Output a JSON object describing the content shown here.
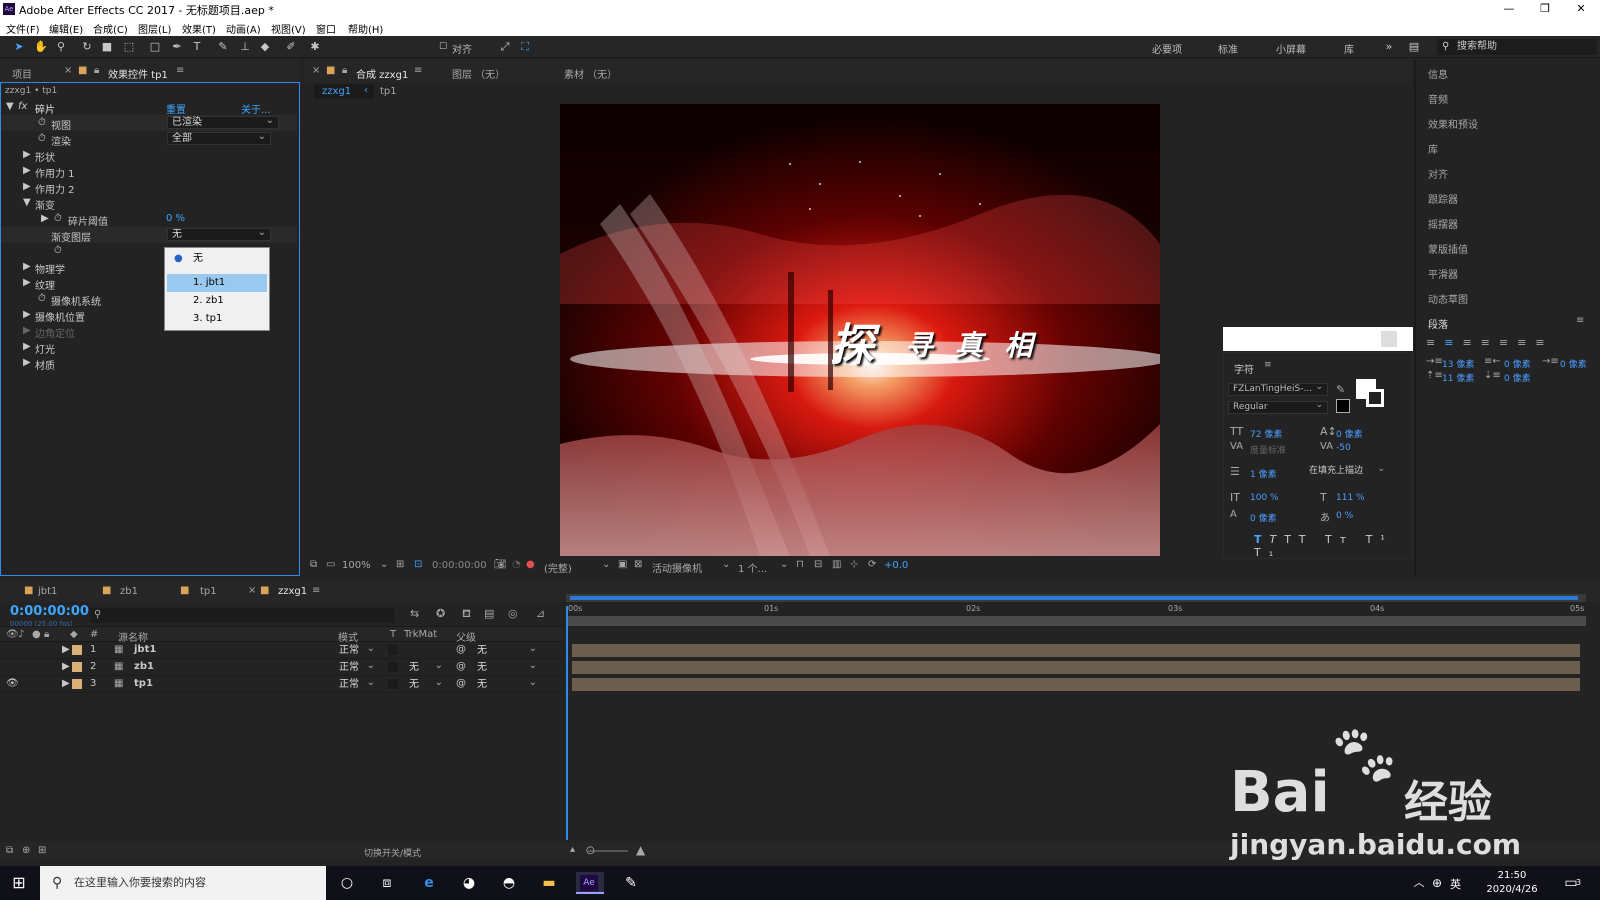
{
  "title_bar": {
    "app_title": "Adobe After Effects CC 2017 - 无标题项目.aep *",
    "logo": "Ae"
  },
  "menu": [
    "文件(F)",
    "编辑(E)",
    "合成(C)",
    "图层(L)",
    "效果(T)",
    "动画(A)",
    "视图(V)",
    "窗口",
    "帮助(H)"
  ],
  "toolbar": {
    "align_label": "对齐",
    "workspaces": [
      "必要项",
      "标准",
      "小屏幕",
      "库"
    ],
    "search_help": "搜索帮助"
  },
  "effects_panel": {
    "tabs": [
      "项目",
      "效果控件 tp1"
    ],
    "breadcrumb": "zzxg1 • tp1",
    "effect_name": "碎片",
    "reset": "重置",
    "about": "关于...",
    "props": [
      {
        "label": "视图",
        "value": "已渲染"
      },
      {
        "label": "渲染",
        "value": "全部"
      },
      {
        "label": "形状"
      },
      {
        "label": "作用力 1"
      },
      {
        "label": "作用力 2"
      },
      {
        "label": "渐变"
      },
      {
        "label": "碎片阈值",
        "value": "0 %"
      },
      {
        "label": "渐变图层",
        "value": "无"
      },
      {
        "label": "物理学"
      },
      {
        "label": "纹理"
      },
      {
        "label": "摄像机系统"
      },
      {
        "label": "摄像机位置"
      },
      {
        "label": "边角定位"
      },
      {
        "label": "灯光"
      },
      {
        "label": "材质"
      }
    ],
    "dropdown_options": [
      "无",
      "1. jbt1",
      "2. zb1",
      "3. tp1"
    ]
  },
  "viewer": {
    "tabs": [
      "合成 zzxg1",
      "图层 （无）",
      "素材 （无）"
    ],
    "breadcrumbs": [
      "zzxg1",
      "tp1"
    ],
    "title_main": "探",
    "title_rest": "寻 真 相",
    "footer": {
      "zoom": "100%",
      "timecode": "0:00:00:00",
      "quality": "(完整)",
      "camera": "活动摄像机",
      "views": "1 个...",
      "exposure": "+0.0"
    }
  },
  "right_panel": {
    "items": [
      "信息",
      "音频",
      "效果和预设",
      "库",
      "对齐",
      "跟踪器",
      "摇摆器",
      "蒙版插值",
      "平滑器",
      "动态草图"
    ],
    "paragraph": {
      "title": "段落",
      "indent_left": "13 像素",
      "indent_right": "0 像素",
      "indent_first": "0 像素",
      "space_before": "11 像素",
      "space_after": "0 像素"
    }
  },
  "character": {
    "title": "字符",
    "font": "FZLanTingHeiS-...",
    "style": "Regular",
    "size": "72 像素",
    "leading": "0 像素",
    "kerning": "度量标准",
    "tracking": "-50",
    "stroke": "1 像素",
    "stroke_mode": "在填充上描边",
    "vscale": "100 %",
    "hscale": "111 %",
    "baseline": "0 像素",
    "tsume": "0 %"
  },
  "timeline": {
    "tabs": [
      "jbt1",
      "zb1",
      "tp1",
      "zzxg1"
    ],
    "timecode": "0:00:00:00",
    "fps": "00000 (25.00 fps)",
    "columns": [
      "#",
      "源名称",
      "模式",
      "T",
      "TrkMat",
      "父级"
    ],
    "ruler": [
      "00s",
      "01s",
      "02s",
      "03s",
      "04s",
      "05s"
    ],
    "layers": [
      {
        "num": "1",
        "name": "jbt1",
        "mode": "正常",
        "trkmat": "",
        "parent": "无"
      },
      {
        "num": "2",
        "name": "zb1",
        "mode": "正常",
        "trkmat": "无",
        "parent": "无"
      },
      {
        "num": "3",
        "name": "tp1",
        "mode": "正常",
        "trkmat": "无",
        "parent": "无"
      }
    ],
    "footer": "切换开关/模式"
  },
  "taskbar": {
    "search_placeholder": "在这里输入你要搜索的内容",
    "time": "21:50",
    "date": "2020/4/26",
    "ime": "英",
    "notif": "3"
  },
  "watermark": {
    "brand": "Bai",
    "brand2": "经验",
    "url": "jingyan.baidu.com"
  }
}
